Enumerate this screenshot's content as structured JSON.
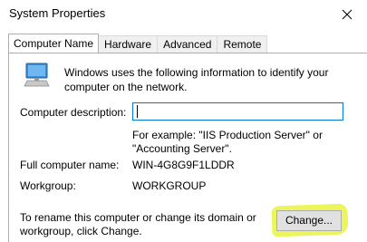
{
  "window": {
    "title": "System Properties"
  },
  "tabs": [
    {
      "label": "Computer Name",
      "active": true
    },
    {
      "label": "Hardware",
      "active": false
    },
    {
      "label": "Advanced",
      "active": false
    },
    {
      "label": "Remote",
      "active": false
    }
  ],
  "computer_name": {
    "info_text": "Windows uses the following information to identify your computer on the network.",
    "description_label": "Computer description:",
    "description_value": "",
    "example_text": "For example: \"IIS Production Server\" or \"Accounting Server\".",
    "full_name_label": "Full computer name:",
    "full_name_value": "WIN-4G8G9F1LDDR",
    "workgroup_label": "Workgroup:",
    "workgroup_value": "WORKGROUP",
    "rename_text": "To rename this computer or change its domain or workgroup, click Change.",
    "change_label": "Change..."
  },
  "icons": {
    "close": "close-icon",
    "computer": "computer-icon"
  },
  "colors": {
    "highlight": "#e6f028",
    "focus_border": "#0078d7"
  }
}
